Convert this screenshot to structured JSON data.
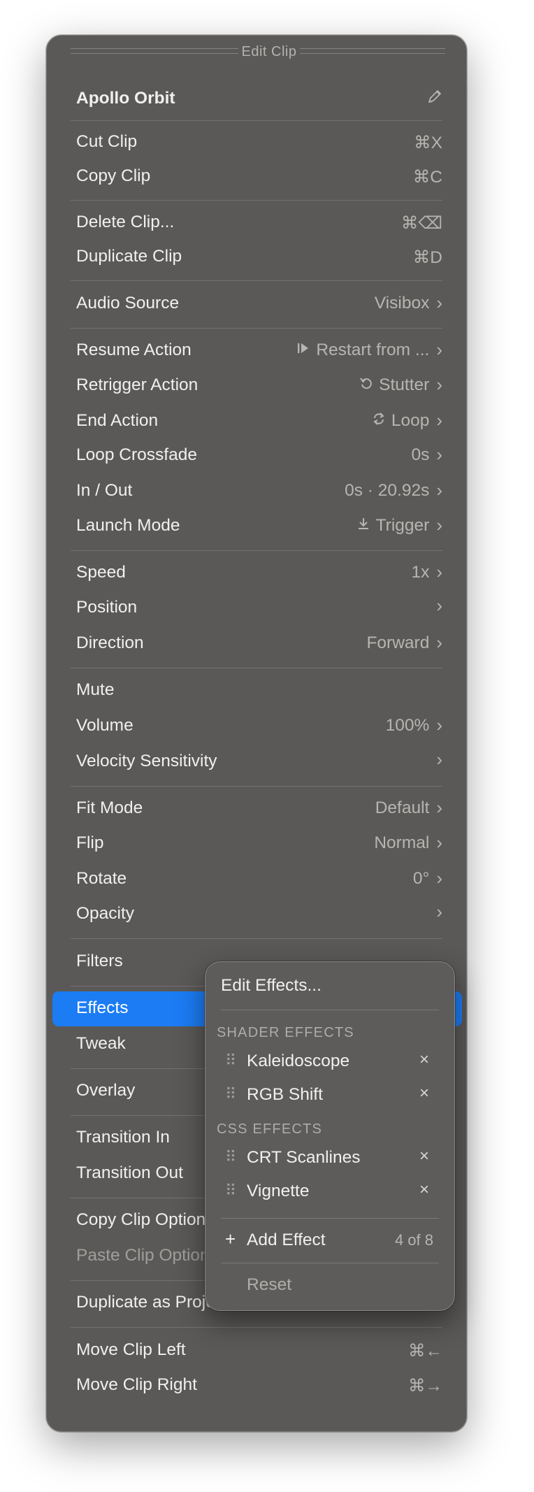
{
  "window": {
    "title": "Edit Clip"
  },
  "header": {
    "clip_name": "Apollo Orbit",
    "edit_icon": "pencil-icon"
  },
  "menu": {
    "cut": {
      "label": "Cut Clip",
      "shortcut": "⌘X"
    },
    "copy": {
      "label": "Copy Clip",
      "shortcut": "⌘C"
    },
    "delete": {
      "label": "Delete Clip...",
      "shortcut": "⌘⌫"
    },
    "duplicate": {
      "label": "Duplicate Clip",
      "shortcut": "⌘D"
    },
    "audio_source": {
      "label": "Audio Source",
      "value": "Visibox"
    },
    "resume_action": {
      "label": "Resume Action",
      "value": "Restart from ...",
      "icon": "play-restart-icon"
    },
    "retrigger_action": {
      "label": "Retrigger Action",
      "value": "Stutter",
      "icon": "rotate-left-icon"
    },
    "end_action": {
      "label": "End Action",
      "value": "Loop",
      "icon": "loop-icon"
    },
    "loop_crossfade": {
      "label": "Loop Crossfade",
      "value": "0s"
    },
    "in_out": {
      "label": "In / Out",
      "value": "0s · 20.92s"
    },
    "launch_mode": {
      "label": "Launch Mode",
      "value": "Trigger",
      "icon": "download-icon"
    },
    "speed": {
      "label": "Speed",
      "value": "1x"
    },
    "position": {
      "label": "Position"
    },
    "direction": {
      "label": "Direction",
      "value": "Forward"
    },
    "mute": {
      "label": "Mute"
    },
    "volume": {
      "label": "Volume",
      "value": "100%"
    },
    "velocity": {
      "label": "Velocity Sensitivity"
    },
    "fit_mode": {
      "label": "Fit Mode",
      "value": "Default"
    },
    "flip": {
      "label": "Flip",
      "value": "Normal"
    },
    "rotate": {
      "label": "Rotate",
      "value": "0°"
    },
    "opacity": {
      "label": "Opacity"
    },
    "filters": {
      "label": "Filters"
    },
    "effects": {
      "label": "Effects"
    },
    "tweak": {
      "label": "Tweak"
    },
    "overlay": {
      "label": "Overlay"
    },
    "transition_in": {
      "label": "Transition In"
    },
    "transition_out": {
      "label": "Transition Out"
    },
    "copy_options": {
      "label": "Copy Clip Options"
    },
    "paste_options": {
      "label": "Paste Clip Options"
    },
    "dup_background": {
      "label": "Duplicate as Project Background"
    },
    "move_left": {
      "label": "Move Clip Left",
      "shortcut": "⌘←"
    },
    "move_right": {
      "label": "Move Clip Right",
      "shortcut": "⌘→"
    }
  },
  "effects_submenu": {
    "edit_effects": "Edit Effects...",
    "shader_header": "SHADER EFFECTS",
    "shader_items": [
      "Kaleidoscope",
      "RGB Shift"
    ],
    "css_header": "CSS EFFECTS",
    "css_items": [
      "CRT Scanlines",
      "Vignette"
    ],
    "add_effect": "Add Effect",
    "count": "4 of 8",
    "reset": "Reset"
  },
  "colors": {
    "menu_bg": "#5b5957",
    "highlight": "#1c7cf4",
    "text": "#f1f0ee",
    "secondary_text": "#b7b5b2"
  }
}
